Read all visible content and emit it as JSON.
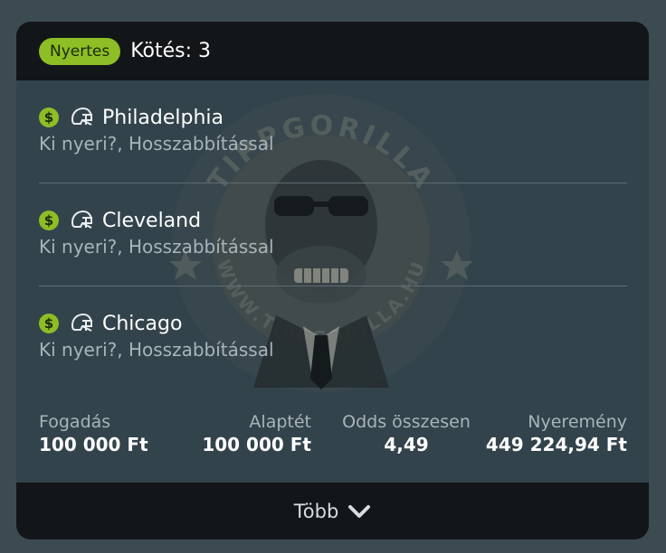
{
  "header": {
    "badge": "Nyertes",
    "title": "Kötés: 3"
  },
  "watermark": {
    "brand": "TIPPGORILLA",
    "url": "WWW.TIPPGORILLA.HU"
  },
  "bets": [
    {
      "icon": "dollar-icon",
      "sport_icon": "football-helmet-icon",
      "team": "Philadelphia",
      "market": "Ki nyeri?, Hosszabbítással"
    },
    {
      "icon": "dollar-icon",
      "sport_icon": "football-helmet-icon",
      "team": "Cleveland",
      "market": "Ki nyeri?, Hosszabbítással"
    },
    {
      "icon": "dollar-icon",
      "sport_icon": "football-helmet-icon",
      "team": "Chicago",
      "market": "Ki nyeri?, Hosszabbítással"
    }
  ],
  "stats": {
    "stake_label": "Fogadás",
    "stake_value": "100 000 Ft",
    "base_label": "Alaptét",
    "base_value": "100 000 Ft",
    "odds_label": "Odds összesen",
    "odds_value": "4,49",
    "win_label": "Nyeremény",
    "win_value": "449 224,94 Ft"
  },
  "footer": {
    "label": "Több",
    "icon": "chevron-down-icon"
  },
  "colors": {
    "accent": "#8dbe26",
    "card": "#33434c",
    "header": "#121619"
  }
}
